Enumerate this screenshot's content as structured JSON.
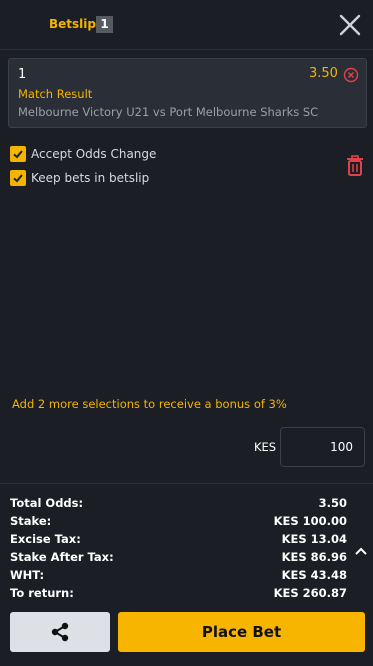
{
  "header": {
    "title": "Betslip",
    "count": "1"
  },
  "selection": {
    "pick": "1",
    "odds": "3.50",
    "market": "Match Result",
    "match": "Melbourne Victory U21 vs Port Melbourne Sharks SC"
  },
  "options": {
    "accept_odds_change": {
      "label": "Accept Odds Change",
      "checked": true
    },
    "keep_bets": {
      "label": "Keep bets in betslip",
      "checked": true
    }
  },
  "bonus_message": "Add 2 more selections to receive a bonus of 3%",
  "stake": {
    "currency": "KES",
    "value": "100"
  },
  "summary": [
    {
      "label": "Total Odds:",
      "value": "3.50"
    },
    {
      "label": "Stake:",
      "value": "KES 100.00"
    },
    {
      "label": "Excise Tax:",
      "value": "KES 13.04"
    },
    {
      "label": "Stake After Tax:",
      "value": "KES 86.96"
    },
    {
      "label": "WHT:",
      "value": "KES 43.48"
    },
    {
      "label": "To return:",
      "value": "KES 260.87"
    }
  ],
  "actions": {
    "place_bet_label": "Place Bet"
  },
  "icons": {
    "close": "close-icon",
    "remove": "remove-selection-icon",
    "trash": "trash-icon",
    "checkbox": "check-icon",
    "chevron": "chevron-up-icon",
    "share": "share-icon"
  },
  "colors": {
    "accent": "#f4b400",
    "background": "#1b1e24",
    "danger": "#e0424b",
    "card": "#2a2e36"
  }
}
